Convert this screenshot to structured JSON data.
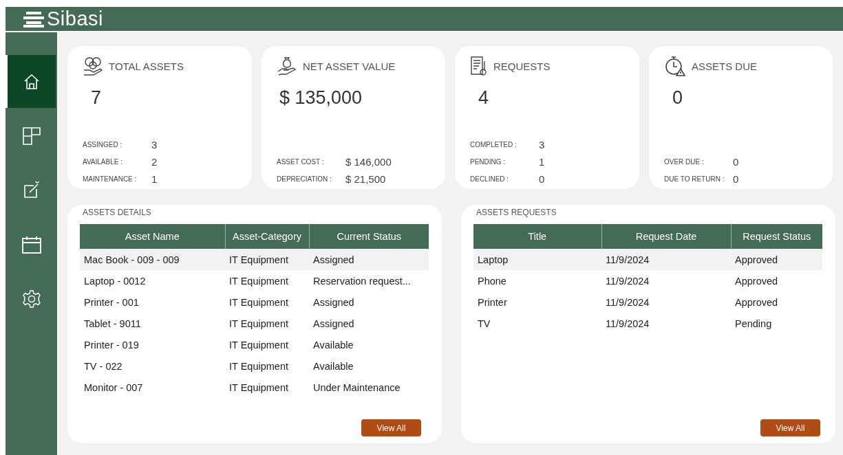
{
  "header": {
    "brand": "Sibasi"
  },
  "sidebar": {
    "items": [
      {
        "kind": "home",
        "selected": true
      },
      {
        "kind": "layout",
        "selected": false
      },
      {
        "kind": "edit",
        "selected": false
      },
      {
        "kind": "calendar",
        "selected": false
      },
      {
        "kind": "settings",
        "selected": false
      }
    ]
  },
  "stats": [
    {
      "kind": "coins",
      "title": "TOTAL ASSETS",
      "value": "7",
      "details": [
        {
          "label": "ASSINGED :",
          "value": "3"
        },
        {
          "label": "AVAILABLE :",
          "value": "2"
        },
        {
          "label": "MAINTENANCE :",
          "value": "1"
        }
      ]
    },
    {
      "kind": "money-bag",
      "title": "NET ASSET VALUE",
      "value": "$ 135,000",
      "details": [
        {
          "label": "ASSET COST :",
          "value": "$ 146,000"
        },
        {
          "label": "DEPRECIATION :",
          "value": "$ 21,500"
        }
      ]
    },
    {
      "kind": "document",
      "title": "REQUESTS",
      "value": "4",
      "details": [
        {
          "label": "COMPLETED :",
          "value": "3"
        },
        {
          "label": "PENDING :",
          "value": "1"
        },
        {
          "label": "DECLINED :",
          "value": "0"
        }
      ]
    },
    {
      "kind": "stopwatch",
      "title": "ASSETS DUE",
      "value": "0",
      "details": [
        {
          "label": "OVER DUE :",
          "value": "0"
        },
        {
          "label": "DUE TO RETURN :",
          "value": "0"
        }
      ]
    }
  ],
  "panels": [
    {
      "title": "ASSETS DETAILS",
      "columns": [
        "Asset Name",
        "Asset-Category",
        "Current Status"
      ],
      "rows": [
        {
          "cells": [
            "Mac Book - 009 - 009",
            "IT Equipment",
            "Assigned"
          ],
          "selected": true
        },
        {
          "cells": [
            "Laptop - 0012",
            "IT Equipment",
            "Reservation request..."
          ],
          "selected": false
        },
        {
          "cells": [
            "Printer - 001",
            "IT Equipment",
            "Assigned"
          ],
          "selected": false
        },
        {
          "cells": [
            "Tablet - 9011",
            "IT Equipment",
            "Assigned"
          ],
          "selected": false
        },
        {
          "cells": [
            "Printer - 019",
            "IT Equipment",
            "Available"
          ],
          "selected": false
        },
        {
          "cells": [
            "TV - 022",
            "IT Equipment",
            "Available"
          ],
          "selected": false
        },
        {
          "cells": [
            "Monitor - 007",
            "IT Equipment",
            "Under Maintenance"
          ],
          "selected": false
        }
      ],
      "button": "View All"
    },
    {
      "title": "ASSETS REQUESTS",
      "columns": [
        "Title",
        "Request Date",
        "Request Status"
      ],
      "rows": [
        {
          "cells": [
            "Laptop",
            "11/9/2024",
            "Approved"
          ],
          "selected": true
        },
        {
          "cells": [
            "Phone",
            "11/9/2024",
            "Approved"
          ],
          "selected": false
        },
        {
          "cells": [
            "Printer",
            "11/9/2024",
            "Approved"
          ],
          "selected": false
        },
        {
          "cells": [
            "TV",
            "11/9/2024",
            "Pending"
          ],
          "selected": false
        }
      ],
      "button": "View All"
    }
  ]
}
